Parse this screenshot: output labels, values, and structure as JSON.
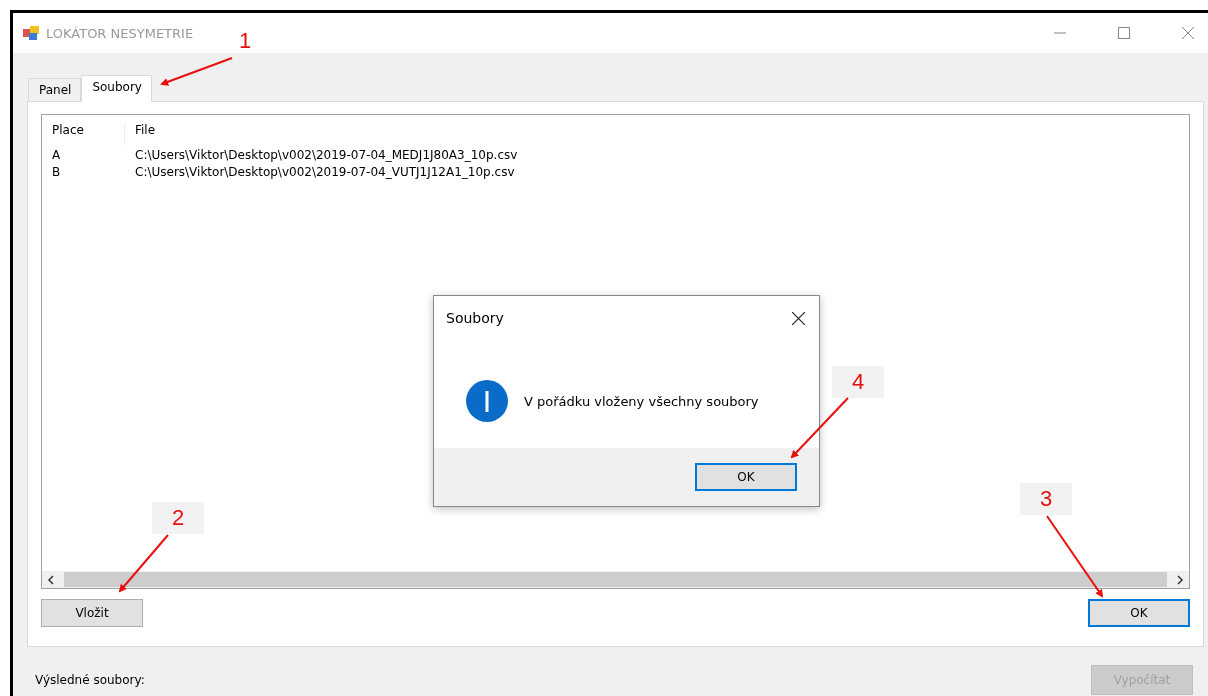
{
  "window": {
    "title": "LOKÁTOR NESYMETRIE"
  },
  "tabs": [
    {
      "label": "Panel",
      "selected": false
    },
    {
      "label": "Soubory",
      "selected": true
    }
  ],
  "list": {
    "columns": [
      "Place",
      "File"
    ],
    "rows": [
      [
        "A",
        "C:\\Users\\Viktor\\Desktop\\v002\\2019-07-04_MEDJ1J80A3_10p.csv"
      ],
      [
        "B",
        "C:\\Users\\Viktor\\Desktop\\v002\\2019-07-04_VUTJ1J12A1_10p.csv"
      ]
    ]
  },
  "panel_buttons": [
    {
      "label": "Vložit",
      "default": false,
      "disabled": false
    },
    {
      "label": "OK",
      "default": true,
      "disabled": false
    }
  ],
  "footer": {
    "label": "Výsledné soubory:",
    "button": {
      "label": "Vypočítat",
      "disabled": true
    }
  },
  "dialog": {
    "title": "Soubory",
    "message": "V pořádku vloženy všechny soubory",
    "button": {
      "label": "OK",
      "default": true
    }
  },
  "annotations": [
    {
      "number": "1"
    },
    {
      "number": "2"
    },
    {
      "number": "3"
    },
    {
      "number": "4"
    }
  ]
}
